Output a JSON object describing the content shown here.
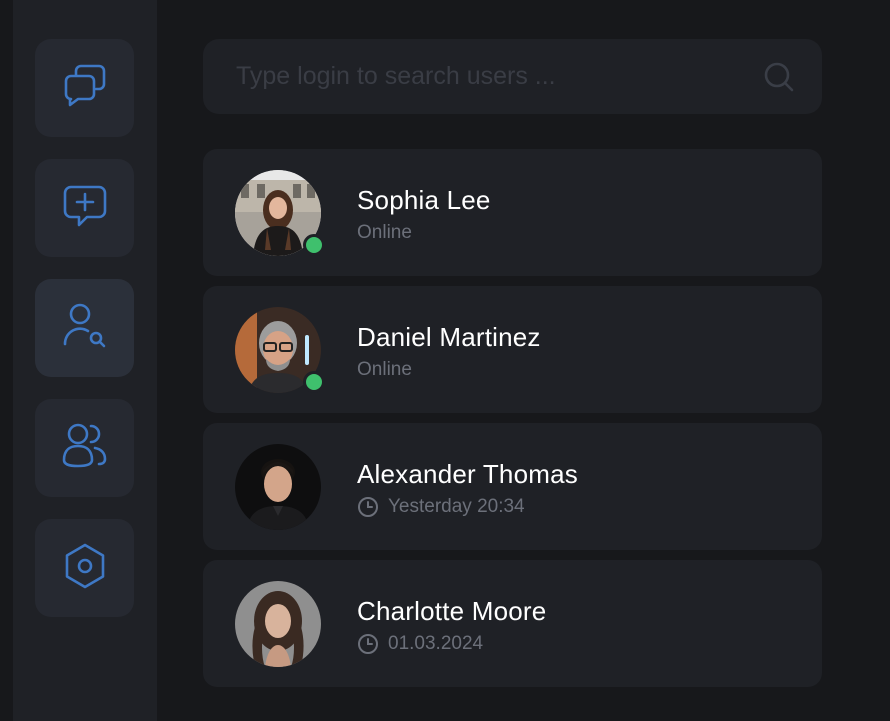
{
  "sidebar": {
    "items": [
      {
        "icon": "chats-icon",
        "active": false
      },
      {
        "icon": "new-chat-icon",
        "active": false
      },
      {
        "icon": "user-search-icon",
        "active": true
      },
      {
        "icon": "contacts-icon",
        "active": false
      },
      {
        "icon": "settings-icon",
        "active": false
      }
    ]
  },
  "search": {
    "placeholder": "Type login to search users ...",
    "value": "",
    "icon": "search-icon"
  },
  "users": [
    {
      "name": "Sophia Lee",
      "status": "Online",
      "online": true
    },
    {
      "name": "Daniel Martinez",
      "status": "Online",
      "online": true
    },
    {
      "name": "Alexander Thomas",
      "status": "Yesterday 20:34",
      "online": false,
      "status_icon": "clock-icon"
    },
    {
      "name": "Charlotte Moore",
      "status": "01.03.2024",
      "online": false,
      "status_icon": "clock-icon"
    }
  ],
  "colors": {
    "background": "#17181b",
    "panel": "#1f2126",
    "accent": "#3e78c5",
    "online": "#3fc06d",
    "muted_text": "#6c707a"
  }
}
